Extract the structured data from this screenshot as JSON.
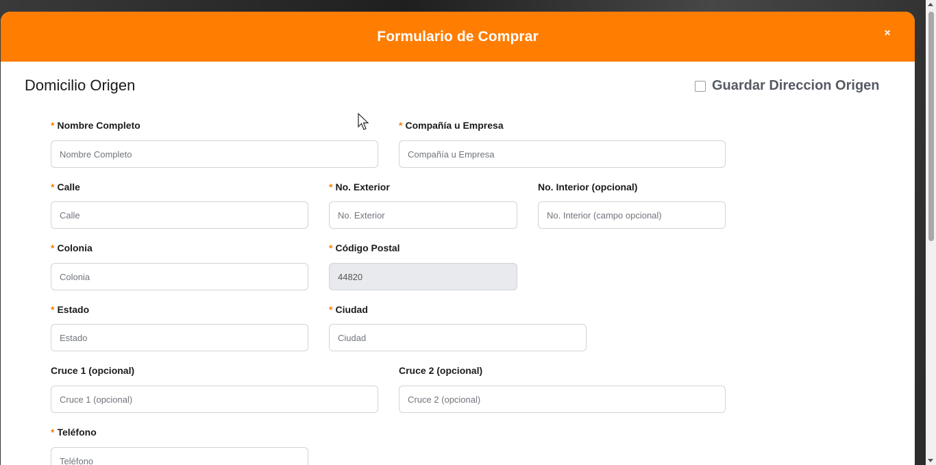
{
  "modal": {
    "title": "Formulario de Comprar",
    "close": "×"
  },
  "section": {
    "title": "Domicilio Origen",
    "save_checkbox_label": "Guardar Direccion Origen"
  },
  "fields": {
    "nombre": {
      "label": "Nombre Completo",
      "placeholder": "Nombre Completo",
      "required": true
    },
    "empresa": {
      "label": "Compañía u Empresa",
      "placeholder": "Compañía u Empresa",
      "required": true
    },
    "calle": {
      "label": "Calle",
      "placeholder": "Calle",
      "required": true
    },
    "exterior": {
      "label": "No. Exterior",
      "placeholder": "No. Exterior",
      "required": true
    },
    "interior": {
      "label": "No. Interior (opcional)",
      "placeholder": "No. Interior (campo opcional)",
      "required": false
    },
    "colonia": {
      "label": "Colonia",
      "placeholder": "Colonia",
      "required": true
    },
    "cp": {
      "label": "Código Postal",
      "value": "44820",
      "required": true
    },
    "estado": {
      "label": "Estado",
      "placeholder": "Estado",
      "required": true
    },
    "ciudad": {
      "label": "Ciudad",
      "placeholder": "Ciudad",
      "required": true
    },
    "cruce1": {
      "label": "Cruce 1 (opcional)",
      "placeholder": "Cruce 1 (opcional)",
      "required": false
    },
    "cruce2": {
      "label": "Cruce 2 (opcional)",
      "placeholder": "Cruce 2 (opcional)",
      "required": false
    },
    "telefono": {
      "label": "Teléfono",
      "placeholder": "Teléfono",
      "required": true
    }
  },
  "required_mark": "*",
  "colors": {
    "accent": "#ff7d00",
    "header_text": "#ffffff"
  }
}
